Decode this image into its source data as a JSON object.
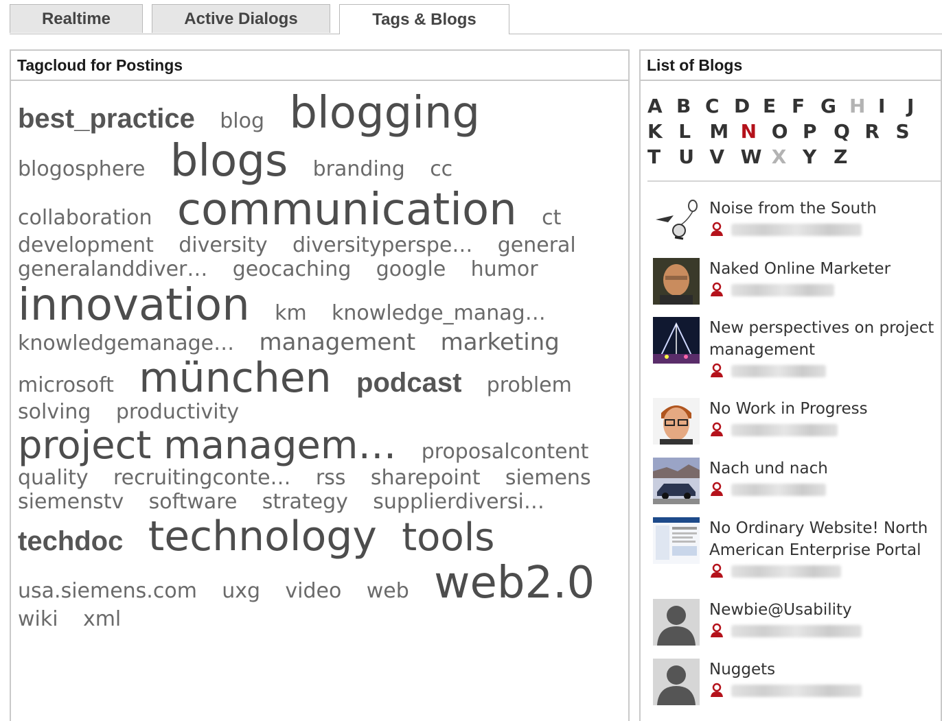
{
  "tabs": [
    {
      "label": "Realtime",
      "active": false
    },
    {
      "label": "Active Dialogs",
      "active": false
    },
    {
      "label": "Tags & Blogs",
      "active": true
    }
  ],
  "tagcloud": {
    "title": "Tagcloud for Postings",
    "tags": [
      {
        "text": "best_practice",
        "weight": 4
      },
      {
        "text": "blog",
        "weight": 1
      },
      {
        "text": "blogging",
        "weight": 7
      },
      {
        "text": "blogosphere",
        "weight": 1
      },
      {
        "text": "blogs",
        "weight": 7
      },
      {
        "text": "branding",
        "weight": 1
      },
      {
        "text": "cc",
        "weight": 1
      },
      {
        "text": "collaboration",
        "weight": 1
      },
      {
        "text": "communication",
        "weight": 7
      },
      {
        "text": "ct",
        "weight": 1
      },
      {
        "text": "development",
        "weight": 1
      },
      {
        "text": "diversity",
        "weight": 1
      },
      {
        "text": "diversityperspe…",
        "weight": 1
      },
      {
        "text": "general",
        "weight": 1
      },
      {
        "text": "generalanddiver…",
        "weight": 1
      },
      {
        "text": "geocaching",
        "weight": 1
      },
      {
        "text": "google",
        "weight": 1
      },
      {
        "text": "humor",
        "weight": 1
      },
      {
        "text": "innovation",
        "weight": 7
      },
      {
        "text": "km",
        "weight": 1
      },
      {
        "text": "knowledge_manag…",
        "weight": 1
      },
      {
        "text": "knowledgemanage…",
        "weight": 1
      },
      {
        "text": "management",
        "weight": 2
      },
      {
        "text": "marketing",
        "weight": 2
      },
      {
        "text": "microsoft",
        "weight": 1
      },
      {
        "text": "münchen",
        "weight": 6
      },
      {
        "text": "podcast",
        "weight": 4
      },
      {
        "text": "problem",
        "weight": 1
      },
      {
        "text": "solving",
        "weight": 1
      },
      {
        "text": "productivity",
        "weight": 1
      },
      {
        "text": "project managem…",
        "weight": 5
      },
      {
        "text": "proposalcontent",
        "weight": 1
      },
      {
        "text": "quality",
        "weight": 1
      },
      {
        "text": "recruitingconte…",
        "weight": 1
      },
      {
        "text": "rss",
        "weight": 1
      },
      {
        "text": "sharepoint",
        "weight": 1
      },
      {
        "text": "siemens",
        "weight": 1
      },
      {
        "text": "siemenstv",
        "weight": 1
      },
      {
        "text": "software",
        "weight": 1
      },
      {
        "text": "strategy",
        "weight": 1
      },
      {
        "text": "supplierdiversi…",
        "weight": 1
      },
      {
        "text": "techdoc",
        "weight": 4
      },
      {
        "text": "technology",
        "weight": 6
      },
      {
        "text": "tools",
        "weight": 5
      },
      {
        "text": "usa.siemens.com",
        "weight": 1
      },
      {
        "text": "uxg",
        "weight": 1
      },
      {
        "text": "video",
        "weight": 1
      },
      {
        "text": "web",
        "weight": 1
      },
      {
        "text": "web2.0",
        "weight": 7
      },
      {
        "text": "wiki",
        "weight": 1
      },
      {
        "text": "xml",
        "weight": 1
      }
    ]
  },
  "blogs": {
    "title": "List of Blogs",
    "alphabet": [
      {
        "l": "A",
        "s": "enabled"
      },
      {
        "l": "B",
        "s": "enabled"
      },
      {
        "l": "C",
        "s": "enabled"
      },
      {
        "l": "D",
        "s": "enabled"
      },
      {
        "l": "E",
        "s": "enabled"
      },
      {
        "l": "F",
        "s": "enabled"
      },
      {
        "l": "G",
        "s": "enabled"
      },
      {
        "l": "H",
        "s": "disabled"
      },
      {
        "l": "I",
        "s": "enabled"
      },
      {
        "l": "J",
        "s": "enabled"
      },
      {
        "l": "K",
        "s": "enabled"
      },
      {
        "l": "L",
        "s": "enabled"
      },
      {
        "l": "M",
        "s": "enabled"
      },
      {
        "l": "N",
        "s": "current"
      },
      {
        "l": "O",
        "s": "enabled"
      },
      {
        "l": "P",
        "s": "enabled"
      },
      {
        "l": "Q",
        "s": "enabled"
      },
      {
        "l": "R",
        "s": "enabled"
      },
      {
        "l": "S",
        "s": "enabled"
      },
      {
        "l": "T",
        "s": "enabled"
      },
      {
        "l": "U",
        "s": "enabled"
      },
      {
        "l": "V",
        "s": "enabled"
      },
      {
        "l": "W",
        "s": "enabled"
      },
      {
        "l": "X",
        "s": "disabled"
      },
      {
        "l": "Y",
        "s": "enabled"
      },
      {
        "l": "Z",
        "s": "enabled"
      }
    ],
    "items": [
      {
        "title": "Noise from the South",
        "thumb": "balloon-sketch",
        "lines": 1
      },
      {
        "title": "Naked Online Marketer",
        "thumb": "person-photo-bald",
        "lines": 1
      },
      {
        "title": "New perspectives on project management",
        "thumb": "night-city-photo",
        "lines": 2
      },
      {
        "title": "No Work in Progress",
        "thumb": "person-photo-glasses",
        "lines": 1
      },
      {
        "title": "Nach und nach",
        "thumb": "car-photo",
        "lines": 1
      },
      {
        "title": "No Ordinary Website! North American Enterprise Portal",
        "thumb": "website-screenshot",
        "lines": 2
      },
      {
        "title": "Newbie@Usability",
        "thumb": "default-avatar",
        "lines": 1
      },
      {
        "title": "Nuggets",
        "thumb": "default-avatar",
        "lines": 1
      }
    ]
  },
  "colors": {
    "accent_red": "#b4121b",
    "tag_text": "#555555",
    "border": "#c9c9c9",
    "tab_bg": "#e6e6e6"
  }
}
